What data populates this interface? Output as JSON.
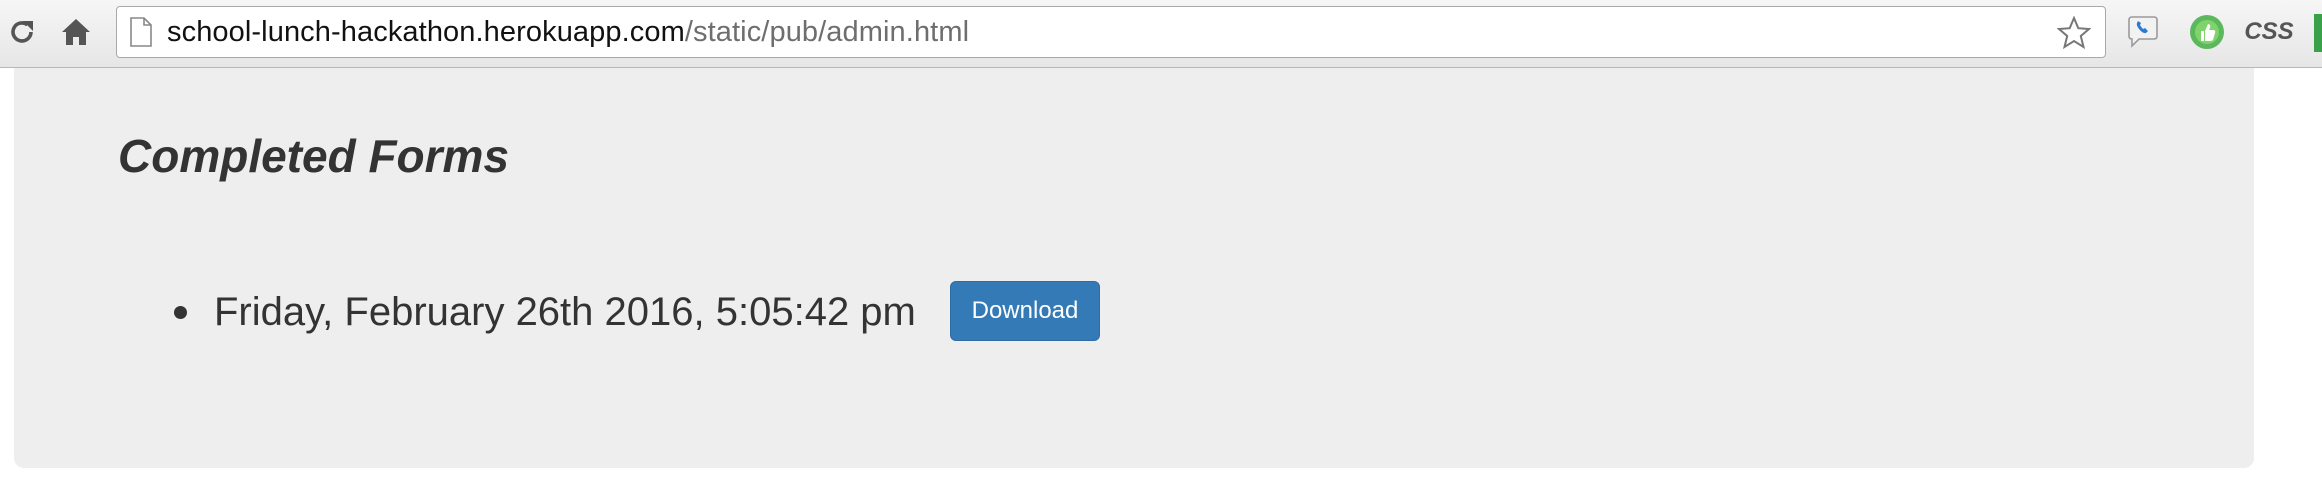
{
  "browser": {
    "url_host": "school-lunch-hackathon.herokuapp.com",
    "url_path": "/static/pub/admin.html",
    "extensions": {
      "css_label": "CSS"
    }
  },
  "page": {
    "heading": "Completed Forms",
    "forms": [
      {
        "timestamp": "Friday, February 26th 2016, 5:05:42 pm",
        "download_label": "Download"
      }
    ]
  },
  "colors": {
    "jumbotron_bg": "#eeeeee",
    "button_primary": "#337ab7",
    "text": "#333333"
  }
}
